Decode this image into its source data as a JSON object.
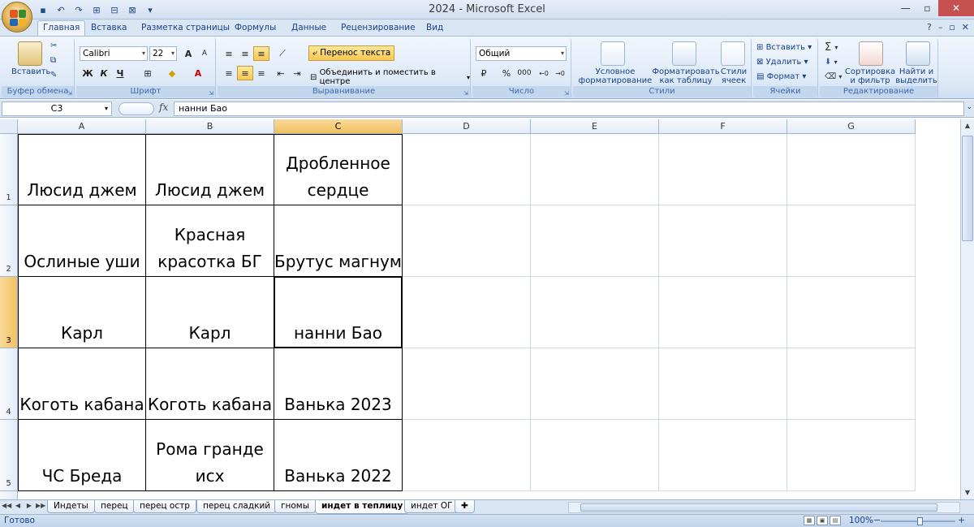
{
  "window": {
    "title": "2024 - Microsoft Excel"
  },
  "qat": {
    "icons": [
      "save-icon",
      "undo-icon",
      "redo-icon",
      "macro-icon",
      "macro-icon",
      "macro-icon"
    ]
  },
  "tabs": [
    "Главная",
    "Вставка",
    "Разметка страницы",
    "Формулы",
    "Данные",
    "Рецензирование",
    "Вид"
  ],
  "active_tab": "Главная",
  "ribbon": {
    "clipboard": {
      "label": "Буфер обмена",
      "paste": "Вставить"
    },
    "font": {
      "label": "Шрифт",
      "name": "Calibri",
      "size": "22",
      "bold": "Ж",
      "italic": "К",
      "underline": "Ч",
      "grow": "A",
      "shrink": "A"
    },
    "alignment": {
      "label": "Выравнивание",
      "wrap": "Перенос текста",
      "merge": "Объединить и поместить в центре"
    },
    "number": {
      "label": "Число",
      "format": "Общий",
      "percent": "%",
      "thousands": "000"
    },
    "styles": {
      "label": "Стили",
      "conditional": "Условное форматирование",
      "as_table": "Форматировать как таблицу",
      "cell_styles": "Стили ячеек"
    },
    "cells": {
      "label": "Ячейки",
      "insert": "Вставить",
      "delete": "Удалить",
      "format": "Формат"
    },
    "editing": {
      "label": "Редактирование",
      "sum": "Σ",
      "sort": "Сортировка и фильтр",
      "find": "Найти и выделить"
    }
  },
  "formula_bar": {
    "name_box": "C3",
    "fx": "fx",
    "content": "нанни Бао"
  },
  "columns": [
    "A",
    "B",
    "C",
    "D",
    "E",
    "F",
    "G"
  ],
  "selected": {
    "col": "C",
    "row": "3"
  },
  "rows": [
    {
      "num": "1",
      "cells": [
        "Люсид джем",
        "Люсид джем",
        "Дробленное сердце",
        "",
        "",
        "",
        ""
      ]
    },
    {
      "num": "2",
      "cells": [
        "Ослиные уши",
        "Красная красотка БГ",
        "Брутус магнум",
        "",
        "",
        "",
        ""
      ]
    },
    {
      "num": "3",
      "cells": [
        "Карл",
        "Карл",
        "нанни Бао",
        "",
        "",
        "",
        ""
      ]
    },
    {
      "num": "4",
      "cells": [
        "Коготь кабана",
        "Коготь кабана",
        "Ванька 2023",
        "",
        "",
        "",
        ""
      ]
    },
    {
      "num": "5",
      "cells": [
        "ЧС Бреда",
        "Рома гранде исх",
        "Ванька 2022",
        "",
        "",
        "",
        ""
      ]
    }
  ],
  "sheets": [
    "Индеты",
    "перец",
    "перец остр",
    "перец сладкий",
    "гномы",
    "индет в теплицу",
    "индет ОГ"
  ],
  "active_sheet": "индет в теплицу",
  "status": {
    "text": "Готово",
    "zoom": "100%",
    "zoom_minus": "−",
    "zoom_plus": "+"
  }
}
